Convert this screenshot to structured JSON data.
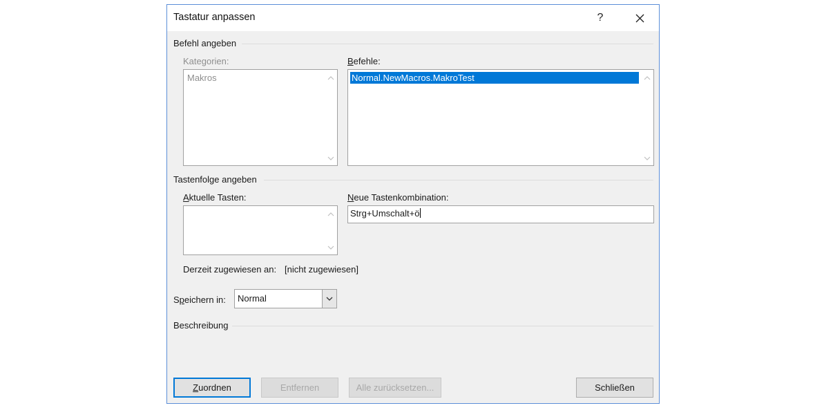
{
  "dialog": {
    "title": "Tastatur anpassen",
    "help_glyph": "?"
  },
  "command_group": {
    "heading": "Befehl angeben",
    "categories_label": "Kategorien:",
    "categories": [
      "Makros"
    ],
    "commands_label": "Befehle:",
    "commands": [
      "Normal.NewMacros.MakroTest"
    ],
    "selected_command_index": 0
  },
  "keys_group": {
    "heading": "Tastenfolge angeben",
    "current_keys_label": "Aktuelle Tasten:",
    "current_keys": [],
    "new_combo_label": "Neue Tastenkombination:",
    "new_combo_value": "Strg+Umschalt+ö",
    "assigned_to_label": "Derzeit zugewiesen an:",
    "assigned_to_value": "[nicht zugewiesen]"
  },
  "save_in": {
    "label": "Speichern in:",
    "value": "Normal"
  },
  "description": {
    "heading": "Beschreibung"
  },
  "buttons": {
    "assign": "Zuordnen",
    "remove": "Entfernen",
    "reset_all": "Alle zurücksetzen...",
    "close": "Schließen"
  },
  "colors": {
    "dialog_border": "#5b8ed8",
    "selection": "#0078d7",
    "dialog_background": "#f0f0f0"
  }
}
